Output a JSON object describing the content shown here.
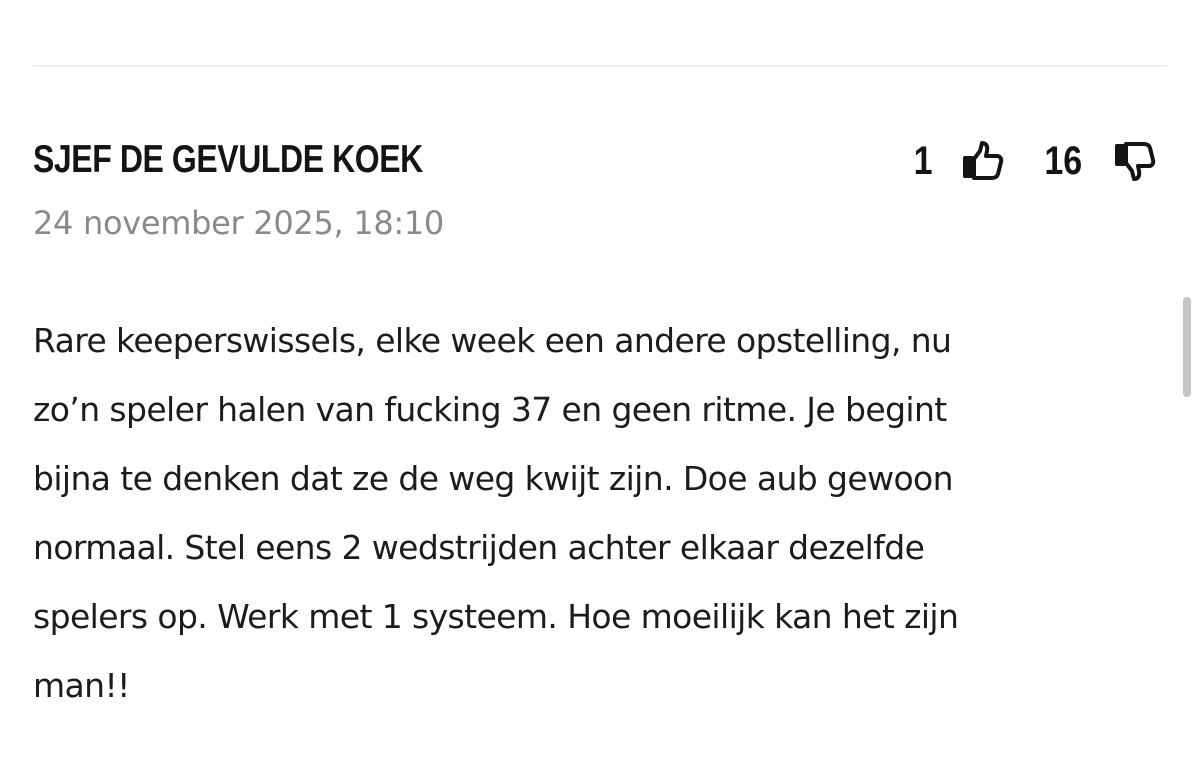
{
  "comment": {
    "author": "SJEF DE GEVULDE KOEK",
    "timestamp": "24 november 2025, 18:10",
    "upvotes": "1",
    "downvotes": "16",
    "upvote_icon": "thumbs-up-icon",
    "downvote_icon": "thumbs-down-icon",
    "body_lines": [
      "Rare keeperswissels, elke week een andere opstelling, nu",
      "zo’n speler halen van fucking 37 en geen ritme. Je begint",
      "bijna te denken dat ze de weg kwijt zijn. Doe aub gewoon",
      "normaal. Stel eens 2 wedstrijden achter elkaar dezelfde",
      "spelers op. Werk met 1 systeem. Hoe moeilijk kan het zijn",
      "man!!"
    ]
  },
  "colors": {
    "text": "#141414",
    "muted": "#8a8a8a",
    "divider": "#eeeeee"
  }
}
